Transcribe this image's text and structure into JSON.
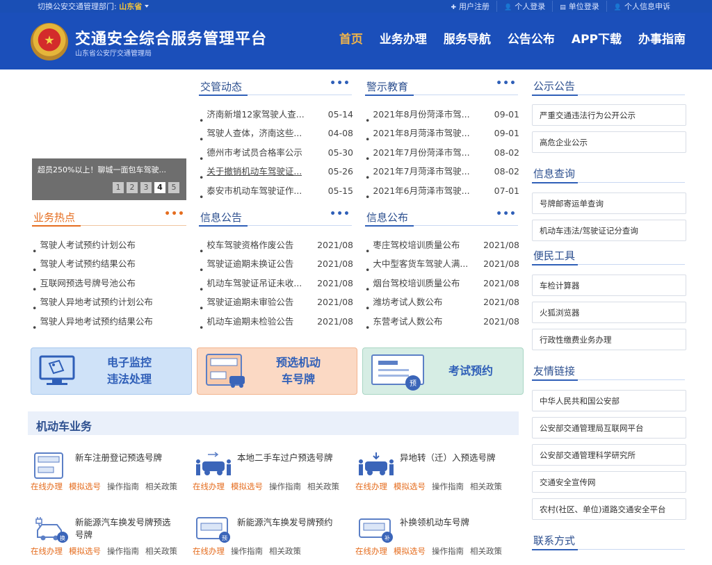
{
  "topbar": {
    "switch_label": "切换公安交通管理部门:",
    "province": "山东省",
    "links": [
      "用户注册",
      "个人登录",
      "单位登录",
      "个人信息申诉"
    ]
  },
  "header": {
    "title": "交通安全综合服务管理平台",
    "subtitle": "山东省公安厅交通管理局",
    "nav": [
      "首页",
      "业务办理",
      "服务导航",
      "公告公布",
      "APP下载",
      "办事指南"
    ]
  },
  "carousel": {
    "caption": "超员250%以上！聊城一面包车驾驶...",
    "pages": [
      "1",
      "2",
      "3",
      "4",
      "5"
    ],
    "active_page": "4"
  },
  "jiaoguan": {
    "title": "交管动态",
    "more": "•••",
    "items": [
      {
        "text": "济南新增12家驾驶人查...",
        "date": "05-14"
      },
      {
        "text": "驾驶人查体，济南这些...",
        "date": "04-08"
      },
      {
        "text": "德州市考试员合格率公示",
        "date": "05-30"
      },
      {
        "text": "关于撤销机动车驾驶证...",
        "date": "05-26"
      },
      {
        "text": "泰安市机动车驾驶证作...",
        "date": "05-15"
      }
    ]
  },
  "jingshi": {
    "title": "警示教育",
    "more": "•••",
    "items": [
      {
        "text": "2021年8月份菏泽市驾...",
        "date": "09-01"
      },
      {
        "text": "2021年8月菏泽市驾驶...",
        "date": "09-01"
      },
      {
        "text": "2021年7月份菏泽市驾...",
        "date": "08-02"
      },
      {
        "text": "2021年7月菏泽市驾驶...",
        "date": "08-02"
      },
      {
        "text": "2021年6月菏泽市驾驶...",
        "date": "07-01"
      }
    ]
  },
  "redian": {
    "title": "业务热点",
    "more": "•••",
    "items": [
      "驾驶人考试预约计划公布",
      "驾驶人考试预约结果公布",
      "互联网预选号牌号池公布",
      "驾驶人异地考试预约计划公布",
      "驾驶人异地考试预约结果公布"
    ]
  },
  "xinxigonggao": {
    "title": "信息公告",
    "more": "•••",
    "items": [
      {
        "text": "校车驾驶资格作废公告",
        "date": "2021/08"
      },
      {
        "text": "驾驶证逾期未换证公告",
        "date": "2021/08"
      },
      {
        "text": "机动车驾驶证吊证未收...",
        "date": "2021/08"
      },
      {
        "text": "驾驶证逾期未审验公告",
        "date": "2021/08"
      },
      {
        "text": "机动车逾期未检验公告",
        "date": "2021/08"
      }
    ]
  },
  "xinxigongbu": {
    "title": "信息公布",
    "more": "•••",
    "items": [
      {
        "text": "枣庄驾校培训质量公布",
        "date": "2021/08"
      },
      {
        "text": "大中型客货车驾驶人满...",
        "date": "2021/08"
      },
      {
        "text": "烟台驾校培训质量公布",
        "date": "2021/08"
      },
      {
        "text": "潍坊考试人数公布",
        "date": "2021/08"
      },
      {
        "text": "东营考试人数公布",
        "date": "2021/08"
      }
    ]
  },
  "big_buttons": [
    {
      "line1": "电子监控",
      "line2": "违法处理",
      "bg": "#cfe2f8",
      "border": "#a9c9ee",
      "color": "#2f5fb8"
    },
    {
      "line1": "预选机动",
      "line2": "车号牌",
      "bg": "#fbd9c4",
      "border": "#f2b48e",
      "color": "#2f5fb8"
    },
    {
      "line1": "考试预约",
      "line2": "",
      "bg": "#d6ede4",
      "border": "#a9d6c4",
      "color": "#2f5fb8"
    }
  ],
  "vehicle": {
    "title": "机动车业务",
    "services": [
      {
        "name": "新车注册登记预选号牌",
        "acts": [
          "在线办理",
          "模拟选号",
          "操作指南",
          "相关政策"
        ]
      },
      {
        "name": "本地二手车过户预选号牌",
        "acts": [
          "在线办理",
          "模拟选号",
          "操作指南",
          "相关政策"
        ]
      },
      {
        "name": "异地转（迁）入预选号牌",
        "acts": [
          "在线办理",
          "模拟选号",
          "操作指南",
          "相关政策"
        ]
      },
      {
        "name": "新能源汽车换发号牌预选号牌",
        "acts": [
          "在线办理",
          "模拟选号",
          "操作指南",
          "相关政策"
        ]
      },
      {
        "name": "新能源汽车换发号牌预约",
        "acts": [
          "在线办理",
          "操作指南",
          "相关政策"
        ]
      },
      {
        "name": "补换领机动车号牌",
        "acts": [
          "在线办理",
          "模拟选号",
          "操作指南",
          "相关政策"
        ]
      }
    ]
  },
  "right": {
    "gonggao": {
      "title": "公示公告",
      "items": [
        "严重交通违法行为公开公示",
        "高危企业公示"
      ]
    },
    "chaxun": {
      "title": "信息查询",
      "items": [
        "号牌邮寄运单查询",
        "机动车违法/驾驶证记分查询"
      ]
    },
    "gongju": {
      "title": "便民工具",
      "items": [
        "车检计算器",
        "火狐浏览器",
        "行政性缴费业务办理"
      ]
    },
    "links": {
      "title": "友情链接",
      "items": [
        "中华人民共和国公安部",
        "公安部交通管理局互联网平台",
        "公安部交通管理科学研究所",
        "交通安全宣传网",
        "农村(社区、单位)道路交通安全平台"
      ]
    },
    "contact": {
      "title": "联系方式"
    }
  },
  "colors": {
    "brand_blue": "#1b4fba",
    "accent_orange": "#e56d1f",
    "nav_active": "#f0b44a"
  }
}
